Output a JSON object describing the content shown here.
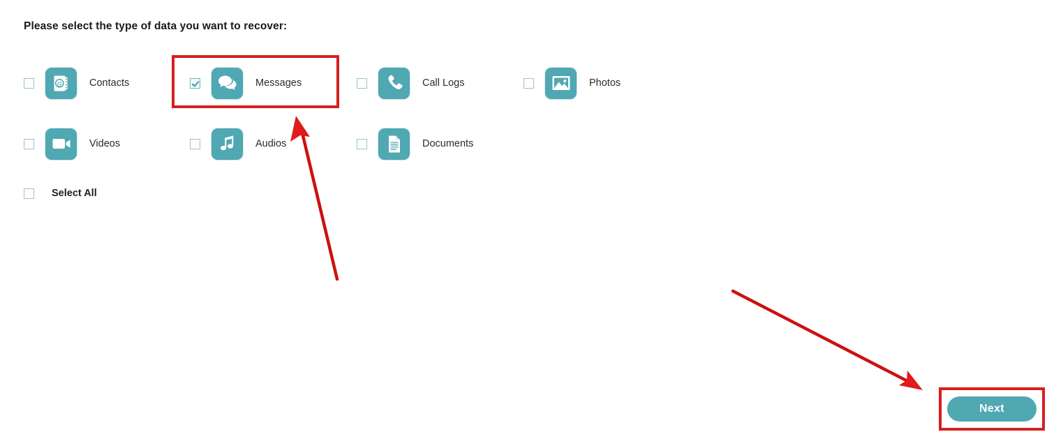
{
  "page": {
    "heading": "Please select the type of data you want to recover:",
    "background_color": "#ffffff",
    "accent_color": "#4fa8b2",
    "annotation_color": "#d81e1e",
    "label_color": "#2b2b2b"
  },
  "options": [
    {
      "id": "contacts",
      "label": "Contacts",
      "icon": "address-book-icon",
      "checked": false
    },
    {
      "id": "messages",
      "label": "Messages",
      "icon": "speech-bubbles-icon",
      "checked": true
    },
    {
      "id": "calllogs",
      "label": "Call Logs",
      "icon": "phone-handset-icon",
      "checked": false
    },
    {
      "id": "photos",
      "label": "Photos",
      "icon": "picture-icon",
      "checked": false
    },
    {
      "id": "videos",
      "label": "Videos",
      "icon": "video-camera-icon",
      "checked": false
    },
    {
      "id": "audios",
      "label": "Audios",
      "icon": "music-note-icon",
      "checked": false
    },
    {
      "id": "documents",
      "label": "Documents",
      "icon": "document-page-icon",
      "checked": false
    }
  ],
  "select_all": {
    "label": "Select All",
    "checked": false
  },
  "footer": {
    "next_label": "Next"
  },
  "annotations": {
    "highlight_messages": "red-rectangle-around-messages-option",
    "highlight_next": "red-rectangle-around-next-button",
    "arrow_to_messages": "red-arrow-pointing-to-messages-option",
    "arrow_to_next": "red-arrow-pointing-to-next-button"
  }
}
